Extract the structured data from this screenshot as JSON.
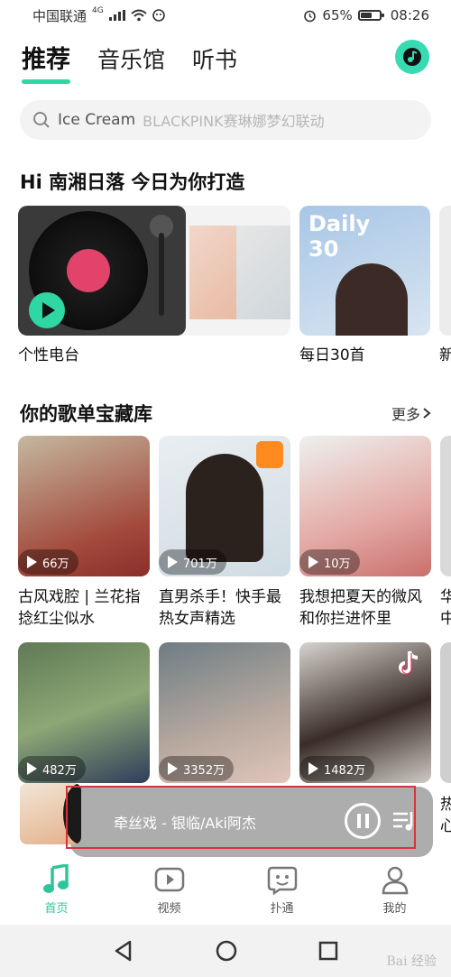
{
  "status_bar": {
    "carrier": "中国联通",
    "network": "4G",
    "battery_percent": "65%",
    "battery_level": 0.65,
    "time": "08:26"
  },
  "tabs": [
    {
      "label": "推荐",
      "active": true
    },
    {
      "label": "音乐馆",
      "active": false
    },
    {
      "label": "听书",
      "active": false
    }
  ],
  "search": {
    "primary": "Ice Cream",
    "secondary": "BLACKPINK赛琳娜梦幻联动"
  },
  "greeting": {
    "title": "Hi 南湘日落  今日为你打造"
  },
  "daily_cards": [
    {
      "label": "个性电台"
    },
    {
      "label": "每日30首",
      "badge_line1": "Daily",
      "badge_line2": "30"
    },
    {
      "label": "新"
    }
  ],
  "playlist_section": {
    "title": "你的歌单宝藏库",
    "more": "更多"
  },
  "playlists_row1": [
    {
      "title_line1": "古风戏腔 | 兰花指",
      "title_line2": "捻红尘似水",
      "plays": "66万"
    },
    {
      "title_line1": "直男杀手！快手最",
      "title_line2": "热女声精选",
      "plays": "701万"
    },
    {
      "title_line1": "我想把夏天的微风",
      "title_line2": "和你拦进怀里",
      "plays": "10万"
    },
    {
      "title_line1": "华",
      "title_line2": "中"
    }
  ],
  "playlists_row2": [
    {
      "plays": "482万"
    },
    {
      "plays": "3352万"
    },
    {
      "plays": "1482万"
    },
    {
      "title_line1": "热",
      "title_line2": "心"
    }
  ],
  "mini_player": {
    "track": "牵丝戏 - 银临/Aki阿杰"
  },
  "bottom_nav": [
    {
      "label": "首页",
      "icon": "music-note-icon",
      "active": true
    },
    {
      "label": "视频",
      "icon": "video-play-icon",
      "active": false
    },
    {
      "label": "扑通",
      "icon": "face-bubble-icon",
      "active": false
    },
    {
      "label": "我的",
      "icon": "profile-icon",
      "active": false
    }
  ],
  "watermark": "Bai 经验",
  "colors": {
    "accent": "#2fd7a3",
    "highlight_box": "#d9323c"
  }
}
